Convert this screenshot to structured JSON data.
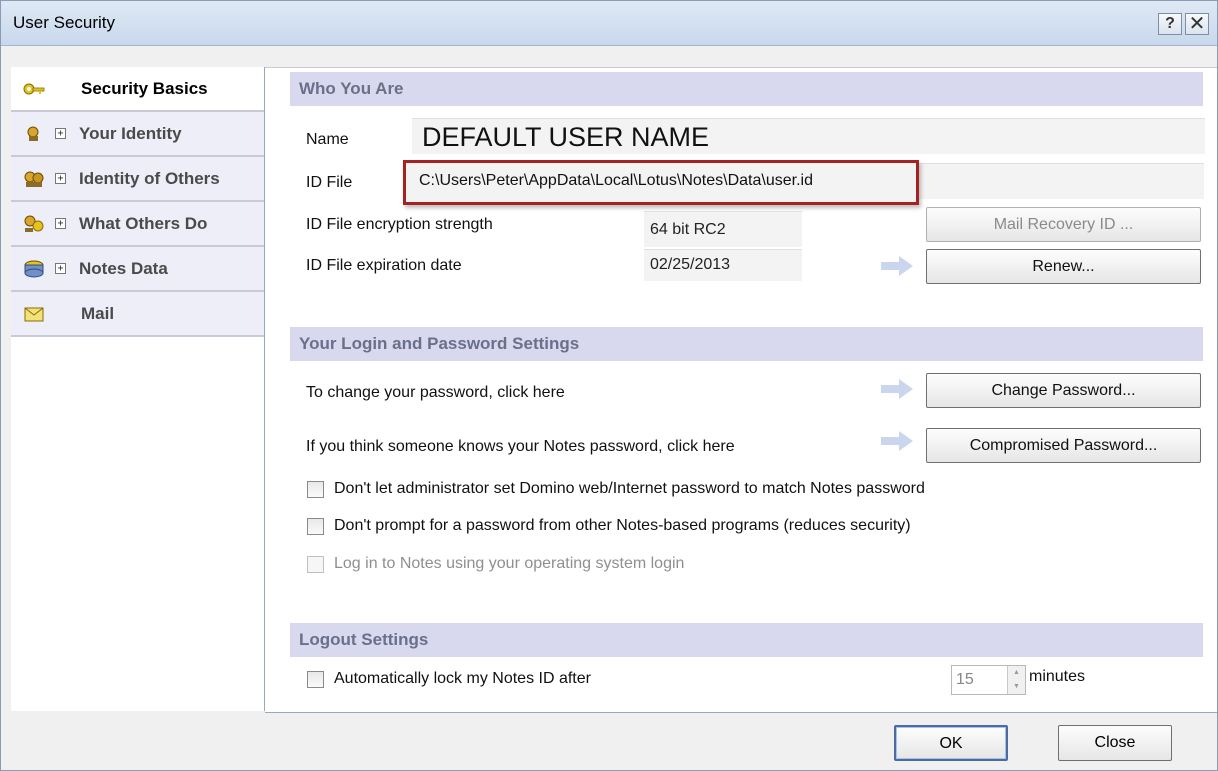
{
  "window": {
    "title": "User Security",
    "help_label": "?",
    "close_label": "✕"
  },
  "nav": {
    "items": [
      {
        "label": "Security Basics",
        "icon": "key-icon"
      },
      {
        "label": "Your Identity",
        "icon": "identity-icon",
        "expander": "+"
      },
      {
        "label": "Identity of Others",
        "icon": "people-icon",
        "expander": "+"
      },
      {
        "label": "What Others Do",
        "icon": "keys-people-icon",
        "expander": "+"
      },
      {
        "label": "Notes Data",
        "icon": "database-icon",
        "expander": "+"
      },
      {
        "label": "Mail",
        "icon": "envelope-icon"
      }
    ]
  },
  "who": {
    "header": "Who You Are",
    "name_label": "Name",
    "name_value": "DEFAULT USER NAME",
    "idfile_label": "ID File",
    "idfile_value": "C:\\Users\\Peter\\AppData\\Local\\Lotus\\Notes\\Data\\user.id",
    "strength_label": "ID File encryption strength",
    "strength_value": "64 bit RC2",
    "expiration_label": "ID File expiration date",
    "expiration_value": "02/25/2013",
    "mail_recovery_button": "Mail Recovery ID ...",
    "renew_button": "Renew..."
  },
  "login": {
    "header": "Your Login and Password Settings",
    "change_text": "To change your password, click here",
    "change_button": "Change Password...",
    "compromised_text": "If you think someone knows your Notes password, click here",
    "compromised_button": "Compromised Password...",
    "options": [
      {
        "label": "Don't let administrator set Domino web/Internet password to match Notes password",
        "checked": false,
        "disabled": false
      },
      {
        "label": "Don't prompt for a password from other Notes-based programs (reduces security)",
        "checked": false,
        "disabled": false
      },
      {
        "label": "Log in to Notes using your operating system login",
        "checked": false,
        "disabled": true
      }
    ]
  },
  "logout": {
    "header": "Logout Settings",
    "auto_lock_label": "Automatically lock my Notes ID after",
    "auto_lock_checked": false,
    "minutes_value": "15",
    "minutes_label": "minutes"
  },
  "footer": {
    "ok": "OK",
    "close": "Close"
  },
  "colors": {
    "section_header_bg": "#d8d9ee",
    "highlight_border": "#a42222",
    "arrow": "#c9d6ee"
  }
}
